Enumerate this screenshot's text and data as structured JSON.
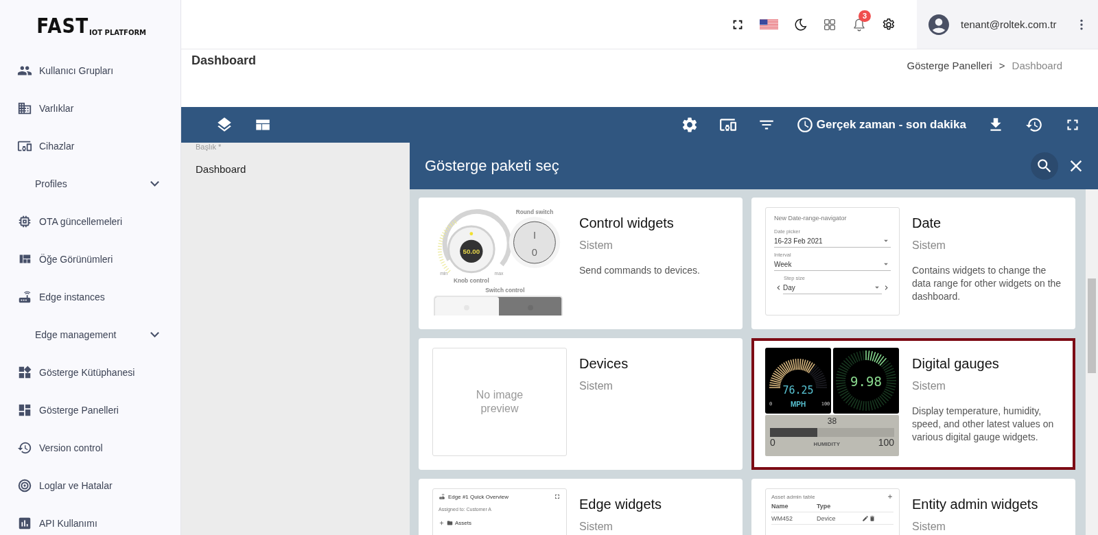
{
  "logo": {
    "main": "FAST",
    "sub": "IOT PLATFORM"
  },
  "sidebar": {
    "items": [
      {
        "kind": "link",
        "label": "Kullanıcı Grupları"
      },
      {
        "kind": "link",
        "label": "Varlıklar"
      },
      {
        "kind": "link",
        "label": "Cihazlar"
      },
      {
        "kind": "group",
        "label": "Profiles",
        "expanded": false
      },
      {
        "kind": "link",
        "label": "OTA güncellemeleri"
      },
      {
        "kind": "link",
        "label": "Öğe Görünümleri"
      },
      {
        "kind": "link",
        "label": "Edge instances"
      },
      {
        "kind": "group",
        "label": "Edge management",
        "expanded": false
      },
      {
        "kind": "link",
        "label": "Gösterge Kütüphanesi"
      },
      {
        "kind": "link",
        "label": "Gösterge Panelleri"
      },
      {
        "kind": "link",
        "label": "Version control"
      },
      {
        "kind": "link",
        "label": "Loglar ve Hatalar"
      },
      {
        "kind": "link",
        "label": "API Kullanımı"
      }
    ]
  },
  "header": {
    "notification_count": "3",
    "user": "tenant@roltek.com.tr"
  },
  "page": {
    "title": "Dashboard",
    "breadcrumb": [
      "Gösterge Panelleri",
      "Dashboard"
    ],
    "breadcrumb_separator": ">"
  },
  "toolbar": {
    "timewindow": "Gerçek zaman - son dakika"
  },
  "form": {
    "label": "Başlık *",
    "value": "Dashboard"
  },
  "bundle_panel": {
    "title": "Gösterge paketi seç",
    "cards": [
      {
        "title": "Control widgets",
        "owner": "Sistem",
        "description": "Send commands to devices.",
        "selected": false,
        "preview": {
          "kind": "control",
          "texts": [
            "Round switch",
            "50.00",
            "min",
            "max",
            "Knob control",
            "I",
            "0",
            "Switch control"
          ]
        }
      },
      {
        "title": "Date",
        "owner": "Sistem",
        "description": "Contains widgets to change the data range for other widgets on the dashboard.",
        "selected": false,
        "preview": {
          "kind": "date",
          "heading": "New Date-range-navigator",
          "fields": [
            {
              "label": "Date picker",
              "value": "16-23 Feb 2021"
            },
            {
              "label": "Interval",
              "value": "Week"
            },
            {
              "label": "Step size",
              "value": "Day"
            }
          ]
        }
      },
      {
        "title": "Devices",
        "owner": "Sistem",
        "selected": false,
        "preview": {
          "kind": "none",
          "text": "No image preview"
        }
      },
      {
        "title": "Digital gauges",
        "owner": "Sistem",
        "description": "Display temperature, humidity, speed, and other latest values on various digital gauge widgets.",
        "selected": true,
        "preview": {
          "kind": "gauges",
          "speed": "76.25",
          "speed_min": "0",
          "speed_unit": "MPH",
          "speed_max": "100",
          "ring": "9.98",
          "humidity": "38",
          "level": 0.38,
          "humidity_min": "0",
          "humidity_label": "HUMIDITY",
          "humidity_max": "100"
        }
      },
      {
        "title": "Edge widgets",
        "owner": "Sistem",
        "selected": false,
        "preview": {
          "kind": "edge",
          "heading": "Edge #1 Quick Overview",
          "subtitle": "Assigned to: Customer A",
          "tree": "Assets"
        }
      },
      {
        "title": "Entity admin widgets",
        "owner": "Sistem",
        "selected": false,
        "preview": {
          "kind": "table",
          "heading": "Asset admin table",
          "columns": [
            "Name",
            "Type"
          ],
          "row": [
            "WM452",
            "Device"
          ]
        }
      }
    ]
  }
}
